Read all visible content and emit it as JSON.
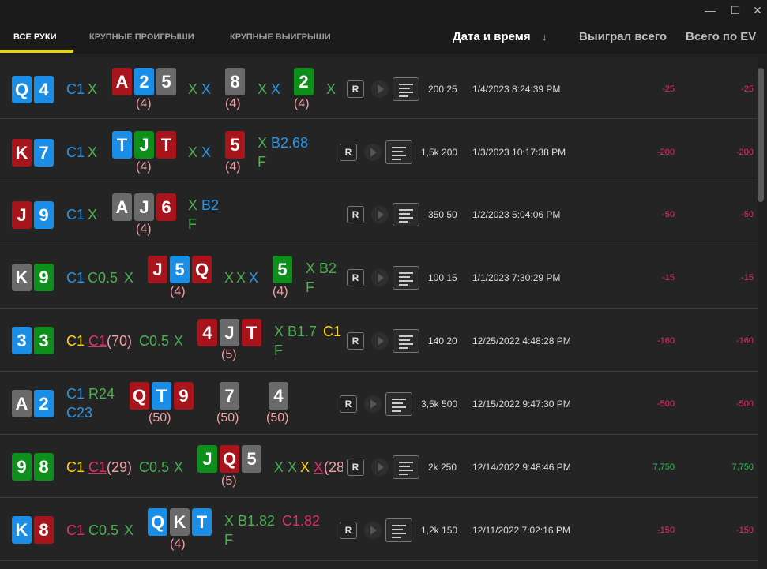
{
  "window": {
    "minimize": "—",
    "maximize": "☐",
    "close": "✕"
  },
  "tabs": [
    "ВСЕ РУКИ",
    "КРУПНЫЕ ПРОИГРЫШИ",
    "КРУПНЫЕ ВЫИГРЫШИ"
  ],
  "columns": {
    "date": "Дата и время",
    "sort_arrow": "↓",
    "won": "Выиграл всего",
    "ev": "Всего по EV"
  },
  "replay_label": "R",
  "hands": [
    {
      "hole": [
        "Q",
        "4"
      ],
      "stakes": "200 25",
      "date": "1/4/2023 8:24:39 PM",
      "won": "-25",
      "ev": "-25",
      "preflop": [
        "C1",
        "X"
      ],
      "flop": [
        "A",
        "2",
        "5"
      ],
      "flop_count": "(4)",
      "flop_act": [
        "X",
        "X"
      ],
      "turn": "8",
      "turn_count": "(4)",
      "turn_act": [
        "X",
        "X"
      ],
      "river": "2",
      "river_count": "(4)",
      "river_act": [
        "X"
      ]
    },
    {
      "hole": [
        "K",
        "7"
      ],
      "stakes": "1,5k 200",
      "date": "1/3/2023 10:17:38 PM",
      "won": "-200",
      "ev": "-200",
      "preflop": [
        "C1",
        "X"
      ],
      "flop": [
        "T",
        "J",
        "T"
      ],
      "flop_count": "(4)",
      "flop_act": [
        "X",
        "X"
      ],
      "turn": "5",
      "turn_count": "(4)",
      "turn_act": [
        "X",
        "B2.68",
        "F"
      ]
    },
    {
      "hole": [
        "J",
        "9"
      ],
      "stakes": "350 50",
      "date": "1/2/2023 5:04:06 PM",
      "won": "-50",
      "ev": "-50",
      "preflop": [
        "C1",
        "X"
      ],
      "flop": [
        "A",
        "J",
        "6"
      ],
      "flop_count": "(4)",
      "flop_act": [
        "X",
        "B2",
        "F"
      ]
    },
    {
      "hole": [
        "K",
        "9"
      ],
      "stakes": "100 15",
      "date": "1/1/2023 7:30:29 PM",
      "won": "-15",
      "ev": "-15",
      "preflop": [
        "C1",
        "C0.5",
        "X"
      ],
      "flop": [
        "J",
        "5",
        "Q"
      ],
      "flop_count": "(4)",
      "flop_act": [
        "X",
        "X",
        "X"
      ],
      "turn": "5",
      "turn_count": "(4)",
      "turn_act": [
        "X",
        "B2",
        "F"
      ]
    },
    {
      "hole": [
        "3",
        "3"
      ],
      "stakes": "140 20",
      "date": "12/25/2022 4:48:28 PM",
      "won": "-160",
      "ev": "-160",
      "preflop": [
        "C1",
        "C1",
        "(70)",
        "C0.5",
        "X"
      ],
      "flop": [
        "4",
        "J",
        "T"
      ],
      "flop_count": "(5)",
      "flop_act": [
        "X",
        "B1.7",
        "C1",
        "F"
      ]
    },
    {
      "hole": [
        "A",
        "2"
      ],
      "stakes": "3,5k 500",
      "date": "12/15/2022 9:47:30 PM",
      "won": "-500",
      "ev": "-500",
      "preflop": [
        "C1",
        "R24",
        "C23"
      ],
      "flop": [
        "Q",
        "T",
        "9"
      ],
      "flop_count": "(50)",
      "turn": "7",
      "turn_count": "(50)",
      "river": "4",
      "river_count": "(50)"
    },
    {
      "hole": [
        "9",
        "8"
      ],
      "stakes": "2k 250",
      "date": "12/14/2022 9:48:46 PM",
      "won": "7,750",
      "ev": "7,750",
      "preflop": [
        "C1",
        "C1",
        "(29)",
        "C0.5",
        "X"
      ],
      "flop": [
        "J",
        "Q",
        "5"
      ],
      "flop_count": "(5)",
      "flop_act": [
        "X",
        "X",
        "X",
        "X",
        "(28"
      ]
    },
    {
      "hole": [
        "K",
        "8"
      ],
      "stakes": "1,2k 150",
      "date": "12/11/2022 7:02:16 PM",
      "won": "-150",
      "ev": "-150",
      "preflop": [
        "C1",
        "C0.5",
        "X"
      ],
      "flop": [
        "Q",
        "K",
        "T"
      ],
      "flop_count": "(4)",
      "flop_act": [
        "X",
        "B1.82",
        "C1.82",
        "F"
      ]
    }
  ]
}
